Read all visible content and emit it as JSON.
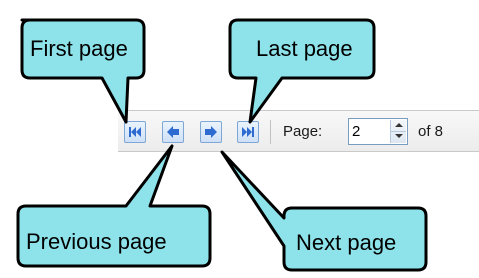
{
  "pager": {
    "page_label": "Page:",
    "current_page": "2",
    "of_text": "of 8"
  },
  "buttons": {
    "first_icon": "first-page-icon",
    "previous_icon": "previous-page-icon",
    "next_icon": "next-page-icon",
    "last_icon": "last-page-icon"
  },
  "callouts": {
    "first_page": "First page",
    "last_page": "Last page",
    "previous_page": "Previous page",
    "next_page": "Next page"
  },
  "colors": {
    "callout_fill": "#8ee3ea",
    "callout_stroke": "#000000",
    "button_border": "#7fa7d6",
    "arrow_blue": "#2d6bd1"
  }
}
